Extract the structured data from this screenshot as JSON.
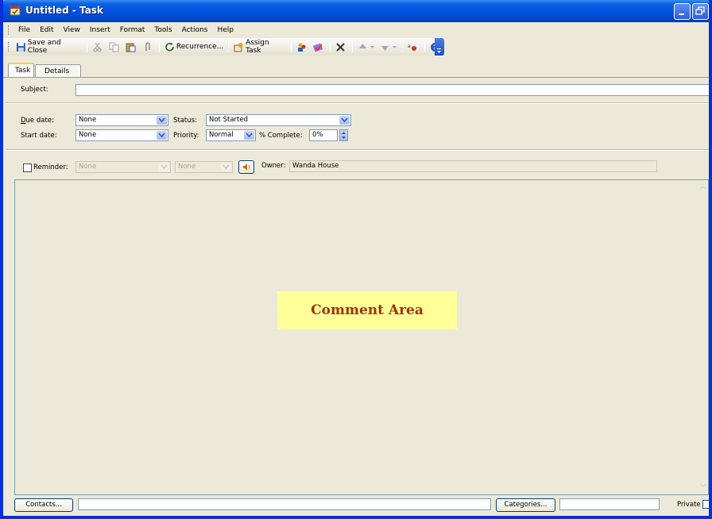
{
  "window": {
    "title": "Untitled - Task"
  },
  "menu": [
    "File",
    "Edit",
    "View",
    "Insert",
    "Format",
    "Tools",
    "Actions",
    "Help"
  ],
  "toolbar": {
    "save_close": "Save and Close",
    "recurrence": "Recurrence...",
    "assign_task": "Assign Task"
  },
  "tabs": [
    "Task",
    "Details"
  ],
  "form": {
    "subject_label": "Subject:",
    "subject_value": "",
    "due_date_label": "Due date:",
    "due_date_value": "None",
    "start_date_label": "Start date:",
    "start_date_value": "None",
    "status_label": "Status:",
    "status_value": "Not Started",
    "priority_label": "Priority:",
    "priority_value": "Normal",
    "complete_label": "% Complete:",
    "complete_value": "0%",
    "reminder_label": "Reminder:",
    "reminder_date": "None",
    "reminder_time": "None",
    "owner_label": "Owner:",
    "owner_value": "Wanda House"
  },
  "comment": {
    "label": "Comment Area"
  },
  "bottom": {
    "contacts_button": "Contacts...",
    "categories_button": "Categories...",
    "private_label": "Private"
  },
  "colors": {
    "titlebar": "#0054e3",
    "highlight": "#ffff99",
    "highlight_text": "#a0330c",
    "tab_accent": "#ffc83c"
  }
}
